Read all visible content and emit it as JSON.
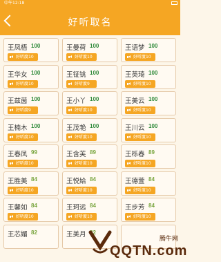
{
  "status": {
    "time": "中午12:18"
  },
  "header": {
    "title": "好听取名",
    "back_icon": "back-arrow-icon"
  },
  "colors": {
    "accent": "#f5a623",
    "score_high": "#2f8a3a",
    "score_low": "#7aa640"
  },
  "badge_prefix": "好听度",
  "names": [
    {
      "name": "王凤梧",
      "score": "100",
      "badge": "好听度10"
    },
    {
      "name": "王曼荷",
      "score": "100",
      "badge": "好听度10"
    },
    {
      "name": "王语梦",
      "score": "100",
      "badge": "好听度10"
    },
    {
      "name": "王华女",
      "score": "100",
      "badge": "好听度10"
    },
    {
      "name": "王钲铫",
      "score": "100",
      "badge": "好听度9"
    },
    {
      "name": "王英琦",
      "score": "100",
      "badge": "好听度10"
    },
    {
      "name": "王兹茵",
      "score": "100",
      "badge": "好听度9"
    },
    {
      "name": "王小丫",
      "score": "100",
      "badge": "好听度10"
    },
    {
      "name": "王美云",
      "score": "100",
      "badge": "好听度10"
    },
    {
      "name": "王楠木",
      "score": "100",
      "badge": "好听度10"
    },
    {
      "name": "王茂艳",
      "score": "100",
      "badge": "好听度10"
    },
    {
      "name": "王川云",
      "score": "100",
      "badge": "好听度10"
    },
    {
      "name": "王春凤",
      "score": "99",
      "badge": "好听度10"
    },
    {
      "name": "王含芙",
      "score": "89",
      "badge": "好听度10"
    },
    {
      "name": "王栎春",
      "score": "89",
      "badge": "好听度10"
    },
    {
      "name": "王胜美",
      "score": "84",
      "badge": "好听度10"
    },
    {
      "name": "王悦姶",
      "score": "84",
      "badge": "好听度10"
    },
    {
      "name": "王德萱",
      "score": "84",
      "badge": "好听度10"
    },
    {
      "name": "王馨如",
      "score": "84",
      "badge": "好听度10"
    },
    {
      "name": "王珂远",
      "score": "84",
      "badge": "好听度10"
    },
    {
      "name": "王步芳",
      "score": "84",
      "badge": "好听度10"
    },
    {
      "name": "王芯媚",
      "score": "82",
      "badge": ""
    },
    {
      "name": "王美月",
      "score": "82",
      "badge": ""
    },
    {
      "name": "",
      "score": "",
      "badge": ""
    }
  ],
  "watermark": {
    "text": "QQTN.com",
    "cn": "腾牛网"
  }
}
